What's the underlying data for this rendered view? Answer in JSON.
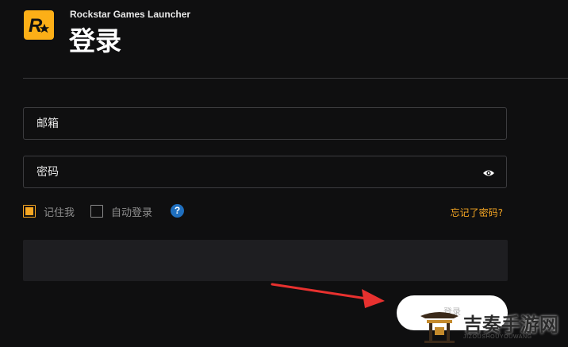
{
  "app": {
    "title": "Rockstar Games Launcher",
    "logo_icon": "rockstar-logo"
  },
  "page": {
    "title": "登录"
  },
  "form": {
    "email": {
      "placeholder": "邮箱",
      "value": ""
    },
    "password": {
      "placeholder": "密码",
      "value": "",
      "toggle_icon": "eye-icon"
    },
    "remember_me": {
      "label": "记住我",
      "checked": true
    },
    "auto_login": {
      "label": "自动登录",
      "checked": false
    },
    "help": {
      "icon": "help-icon",
      "label": "?"
    },
    "forgot_password": {
      "label": "忘记了密码?"
    },
    "login_button": {
      "label": "登录"
    }
  },
  "watermark": {
    "text": "吉奏手游网",
    "subtext": "JIZOUSHOUYOUWANG"
  },
  "colors": {
    "background": "#0f0f10",
    "accent": "#f5a623",
    "logo_bg": "#fcaf17",
    "info_box": "#1e1e21",
    "help_blue": "#1f6fbf",
    "arrow": "#e8312f"
  }
}
